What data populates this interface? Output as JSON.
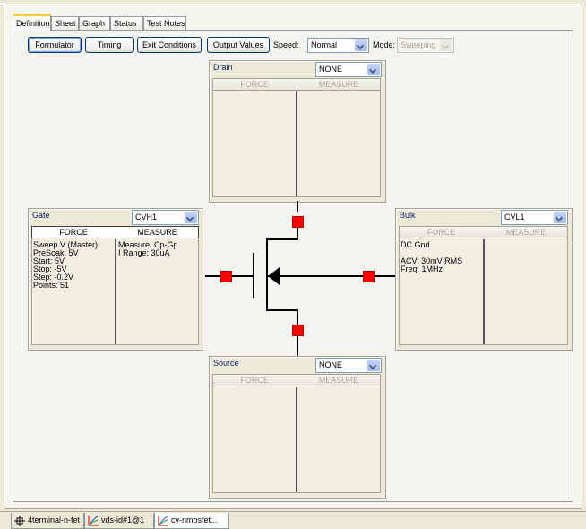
{
  "tabs": [
    {
      "label": "Definition",
      "active": true
    },
    {
      "label": "Sheet",
      "active": false
    },
    {
      "label": "Graph",
      "active": false
    },
    {
      "label": "Status",
      "active": false
    },
    {
      "label": "Test Notes",
      "active": false
    }
  ],
  "toolbar": {
    "formulator": "Formulator",
    "timing": "Timing",
    "exit_conditions": "Exit Conditions",
    "output_values": "Output Values",
    "speed_label": "Speed:",
    "speed_value": "Normal",
    "mode_label": "Mode:",
    "mode_value": "Sweeping"
  },
  "terminals": {
    "drain": {
      "name": "Drain",
      "smu": "NONE",
      "force": "FORCE",
      "measure": "MEASURE",
      "force_text": "",
      "measure_text": ""
    },
    "gate": {
      "name": "Gate",
      "smu": "CVH1",
      "force": "FORCE",
      "measure": "MEASURE",
      "force_text": "Sweep V (Master)\nPreSoak: 5V\nStart: 5V\nStop: -5V\nStep: -0.2V\nPoints: 51",
      "measure_text": "Measure: Cp-Gp\nI Range: 30uA"
    },
    "bulk": {
      "name": "Bulk",
      "smu": "CVL1",
      "force": "FORCE",
      "measure": "MEASURE",
      "force_text": "DC Gnd\n\nACV: 30mV RMS\nFreq: 1MHz",
      "measure_text": ""
    },
    "source": {
      "name": "Source",
      "smu": "NONE",
      "force": "FORCE",
      "measure": "MEASURE",
      "force_text": "",
      "measure_text": ""
    }
  },
  "status_docs": [
    {
      "label": "4terminal-n-fet",
      "icon": "device-icon",
      "active": false
    },
    {
      "label": "vds-id#1@1",
      "icon": "test-icon",
      "active": false
    },
    {
      "label": "cv-nmosfet...",
      "icon": "test-icon",
      "active": true
    }
  ],
  "colors": {
    "node": "#ff0000",
    "title_text": "#0a246a",
    "tab_highlight": "#ffc83c"
  }
}
